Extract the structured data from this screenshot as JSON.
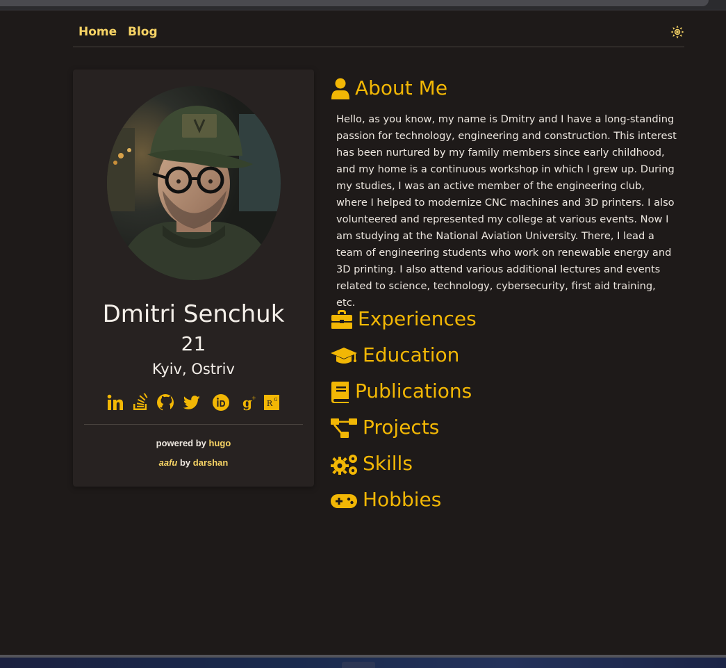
{
  "nav": {
    "home_label": "Home",
    "blog_label": "Blog",
    "theme_toggle_icon": "sun-icon"
  },
  "profile": {
    "name": "Dmitri Senchuk",
    "age": "21",
    "location": "Kyiv, Ostriv",
    "avatar_alt": "profile photo",
    "social": [
      {
        "icon": "linkedin-icon"
      },
      {
        "icon": "stackoverflow-icon"
      },
      {
        "icon": "github-icon"
      },
      {
        "icon": "twitter-icon"
      },
      {
        "icon": "orcid-icon"
      },
      {
        "icon": "google-scholar-icon"
      },
      {
        "icon": "researchgate-icon"
      }
    ]
  },
  "footer": {
    "powered_prefix": "powered by",
    "powered_link": "hugo",
    "theme_name": "aafu",
    "theme_by": "by",
    "theme_author": "darshan"
  },
  "about": {
    "heading": "About Me",
    "text": "Hello, as you know, my name is Dmitry and I have a long-standing passion for technology, engineering and construction. This interest has been nurtured by my family members since early childhood, and my home is a continuous workshop in which I grew up. During my studies, I was an active member of the engineering club, where I helped to modernize CNC machines and 3D printers. I also volunteered and represented my college at various events. Now I am studying at the National Aviation University. There, I lead a team of engineering students who work on renewable energy and 3D printing. I also attend various additional lectures and events related to science, technology, cybersecurity, first aid training, etc."
  },
  "sections": [
    {
      "label": "Experiences",
      "icon": "briefcase-icon"
    },
    {
      "label": "Education",
      "icon": "graduation-cap-icon"
    },
    {
      "label": "Publications",
      "icon": "book-icon"
    },
    {
      "label": "Projects",
      "icon": "project-diagram-icon"
    },
    {
      "label": "Skills",
      "icon": "cogs-icon"
    },
    {
      "label": "Hobbies",
      "icon": "gamepad-icon"
    }
  ],
  "colors": {
    "background": "#1e1a19",
    "card": "#272221",
    "accent": "#f2b705",
    "nav_link": "#f6d365",
    "text": "#ece6df"
  }
}
